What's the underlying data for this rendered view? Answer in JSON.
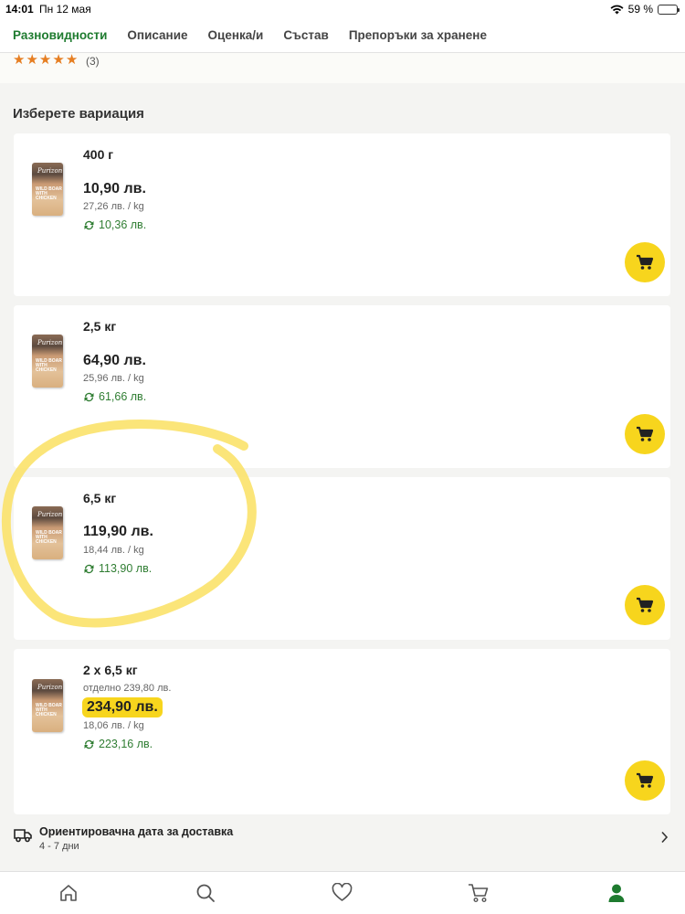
{
  "status_bar": {
    "time": "14:01",
    "date": "Пн 12 мая",
    "battery": "59 %",
    "battery_level": 0.59
  },
  "tabs": [
    {
      "label": "Разновидности",
      "active": true
    },
    {
      "label": "Описание",
      "active": false
    },
    {
      "label": "Оценка/и",
      "active": false
    },
    {
      "label": "Състав",
      "active": false
    },
    {
      "label": "Препоръки за хранене",
      "active": false
    }
  ],
  "rating": {
    "stars": 5,
    "count": "(3)"
  },
  "section_title": "Изберете вариация",
  "product_image": {
    "brand": "Purizon",
    "label": "WILD BOAR WITH CHICKEN"
  },
  "variants": [
    {
      "name": "400 г",
      "price": "10,90 лв.",
      "unit_price": "27,26 лв. / kg",
      "repeat_price": "10,36 лв."
    },
    {
      "name": "2,5 кг",
      "price": "64,90 лв.",
      "unit_price": "25,96 лв. / kg",
      "repeat_price": "61,66 лв."
    },
    {
      "name": "6,5 кг",
      "price": "119,90 лв.",
      "unit_price": "18,44 лв. / kg",
      "repeat_price": "113,90 лв."
    },
    {
      "name": "2 x 6,5 кг",
      "separate_price": "отделно 239,80 лв.",
      "price": "234,90 лв.",
      "unit_price": "18,06 лв. / kg",
      "repeat_price": "223,16 лв."
    }
  ],
  "delivery": {
    "title": "Ориентировачна дата за доставка",
    "days": "4 - 7 дни"
  },
  "bottom_nav": [
    "home-icon",
    "search-icon",
    "heart-icon",
    "cart-icon",
    "account-icon"
  ],
  "colors": {
    "accent": "#1e7b2f",
    "cart_button": "#f7d51d",
    "repeat": "#2f7d32",
    "star": "#e67e22",
    "annotation": "#fbe26a"
  }
}
